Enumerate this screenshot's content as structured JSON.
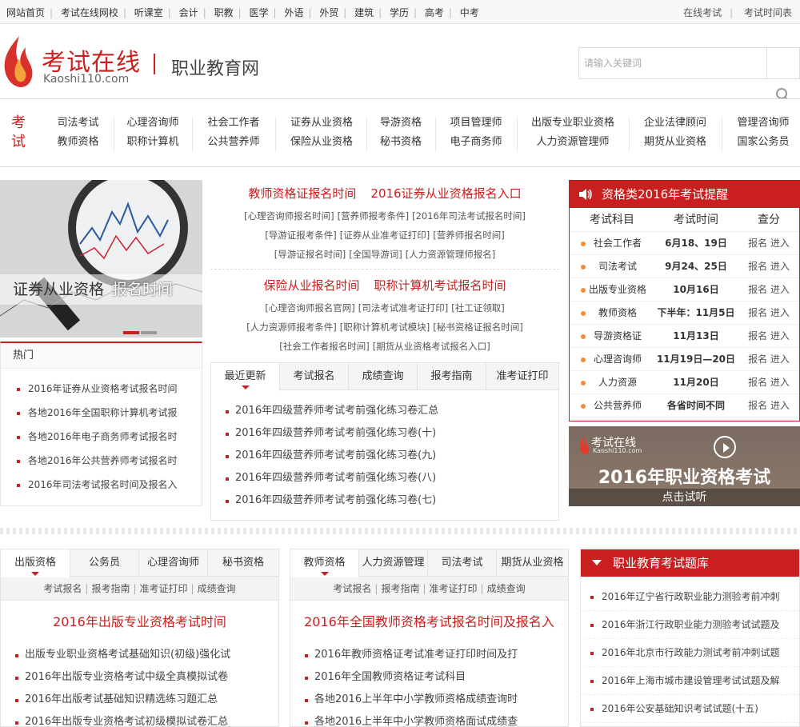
{
  "topnav": {
    "left": [
      "网站首页",
      "考试在线网校",
      "听课室",
      "会计",
      "职教",
      "医学",
      "外语",
      "外贸",
      "建筑",
      "学历",
      "高考",
      "中考"
    ],
    "right": [
      "在线考试",
      "考试时间表"
    ]
  },
  "header": {
    "logo_text": "考试在线",
    "logo_domain": "Kaoshi110.com",
    "site_name": "职业教育网",
    "search_placeholder": "请输入关键词"
  },
  "category": {
    "title": "考试",
    "columns": [
      [
        "司法考试",
        "教师资格"
      ],
      [
        "心理咨询师",
        "职称计算机"
      ],
      [
        "社会工作者",
        "公共营养师"
      ],
      [
        "证券从业资格",
        "保险从业资格"
      ],
      [
        "导游资格",
        "秘书资格"
      ],
      [
        "项目管理师",
        "电子商务师"
      ],
      [
        "出版专业职业资格",
        "人力资源管理师"
      ],
      [
        "企业法律顾问",
        "期货从业资格"
      ],
      [
        "管理咨询师",
        "国家公务员"
      ]
    ]
  },
  "banner": {
    "caption": "证券从业资格",
    "caption_sub": "报名时间"
  },
  "hot": {
    "title": "热门",
    "items": [
      "2016年证券从业资格考试报名时间",
      "各地2016年全国职称计算机考试报",
      "各地2016年电子商务师考试报名时",
      "各地2016年公共营养师考试报名时",
      "2016年司法考试报名时间及报名入"
    ]
  },
  "center": {
    "block1_heads": [
      "教师资格证报名时间",
      "2016证券从业资格报名入口"
    ],
    "block1_rows": [
      [
        "[心理咨询师报名时间]",
        "[营养师报考条件]",
        "[2016年司法考试报名时间]"
      ],
      [
        "[导游证报考条件]",
        "[证券从业准考证打印]",
        "[营养师报名时间]"
      ],
      [
        "[导游证报名时间]",
        "[全国导游词]",
        "[人力资源管理师报名]"
      ]
    ],
    "block2_heads": [
      "保险从业报名时间",
      "职称计算机考试报名时间"
    ],
    "block2_rows": [
      [
        "[心理咨询师报名官网]",
        "[司法考试准考证打印]",
        "[社工证领取]"
      ],
      [
        "[人力资源师报考条件]",
        "[职称计算机考试模块]",
        "[秘书资格证报名时间]"
      ],
      [
        "[社会工作者报名时间]",
        "[期货从业资格考试报名入口]"
      ]
    ]
  },
  "center_tabs": {
    "tabs": [
      "最近更新",
      "考试报名",
      "成绩查询",
      "报考指南",
      "准考证打印"
    ],
    "items": [
      "2016年四级营养师考试考前强化练习卷汇总",
      "2016年四级营养师考试考前强化练习卷(十)",
      "2016年四级营养师考试考前强化练习卷(九)",
      "2016年四级营养师考试考前强化练习卷(八)",
      "2016年四级营养师考试考前强化练习卷(七)"
    ]
  },
  "reminder": {
    "title": "资格类2016年考试提醒",
    "headers": [
      "考试科目",
      "考试时间",
      "查分"
    ],
    "rows": [
      {
        "subject": "社会工作者",
        "time": "6月18、19日",
        "action": "报名 进入"
      },
      {
        "subject": "司法考试",
        "time": "9月24、25日",
        "action": "报名 进入"
      },
      {
        "subject": "出版专业资格",
        "time": "10月16日",
        "action": "报名 进入"
      },
      {
        "subject": "教师资格",
        "time": "下半年：11月5日",
        "action": "报名 进入"
      },
      {
        "subject": "导游资格证",
        "time": "11月13日",
        "action": "报名 进入"
      },
      {
        "subject": "心理咨询师",
        "time": "11月19日—20日",
        "action": "报名 进入"
      },
      {
        "subject": "人力资源",
        "time": "11月20日",
        "action": "报名 进入"
      },
      {
        "subject": "公共营养师",
        "time": "各省时间不同",
        "action": "报名 进入"
      }
    ]
  },
  "promo": {
    "logo": "考试在线",
    "domain": "Kaoshi110.com",
    "title": "2016年职业资格考试",
    "button": "点击试听"
  },
  "box_left": {
    "tabs": [
      "出版资格",
      "公务员",
      "心理咨询师",
      "秘书资格"
    ],
    "sub": [
      "考试报名",
      "报考指南",
      "准考证打印",
      "成绩查询"
    ],
    "title": "2016年出版专业资格考试时间",
    "items": [
      "出版专业职业资格考试基础知识(初级)强化试",
      "2016年出版专业资格考试中级全真模拟试卷",
      "2016年出版考试基础知识精选练习题汇总",
      "2016年出版专业资格考试初级模拟试卷汇总"
    ]
  },
  "box_mid": {
    "tabs": [
      "教师资格",
      "人力资源管理",
      "司法考试",
      "期货从业资格"
    ],
    "sub": [
      "考试报名",
      "报考指南",
      "准考证打印",
      "成绩查询"
    ],
    "title": "2016年全国教师资格考试报名时间及报名入",
    "items": [
      "2016年教师资格证考试准考证打印时间及打",
      "2016年全国教师资格证考试科目",
      "各地2016上半年中小学教师资格成绩查询时",
      "各地2016上半年中小学教师资格面试成绩查"
    ]
  },
  "qbank": {
    "title": "职业教育考试题库",
    "items": [
      "2016年辽宁省行政职业能力测验考前冲刺",
      "2016年浙江行政职业能力测验考试试题及",
      "2016年北京市行政能力测试考前冲刺试题",
      "2016年上海市城市建设管理考试试题及解",
      "2016年公安基础知识考试试题(十五)"
    ]
  }
}
